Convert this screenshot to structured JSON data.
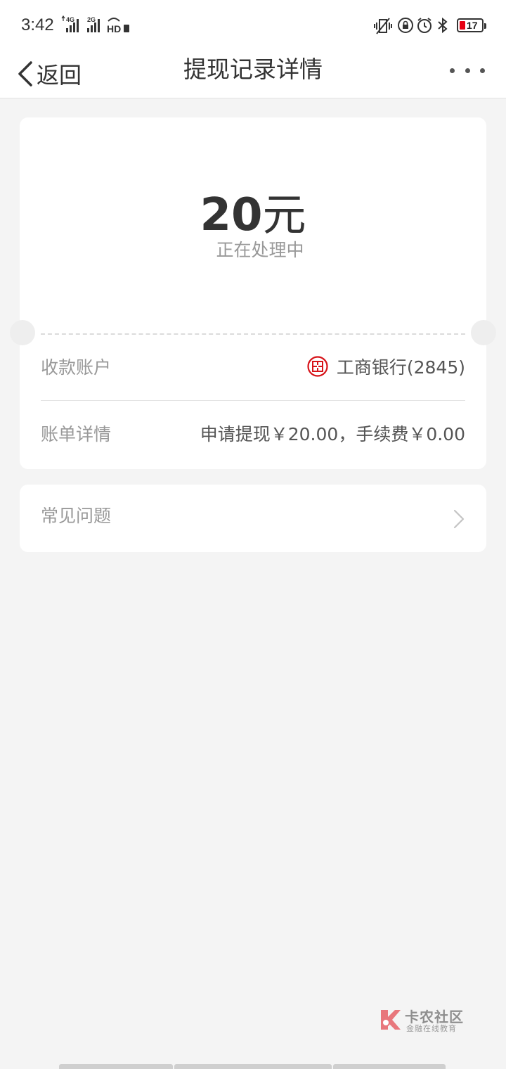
{
  "status_bar": {
    "time": "3:42",
    "network_1": "4G",
    "network_2": "2G",
    "hd_label": "HD",
    "battery_level": "17",
    "icons": [
      "vibrate-icon",
      "lock-rotation-icon",
      "alarm-icon",
      "bluetooth-icon",
      "battery-icon"
    ]
  },
  "nav": {
    "back_label": "返回",
    "title": "提现记录详情",
    "more_icon": "more-dots-icon"
  },
  "detail": {
    "amount": "20",
    "unit": "元",
    "status": "正在处理中",
    "rows": [
      {
        "label": "收款账户",
        "value": "工商银行(2845)",
        "icon": "icbc-logo"
      },
      {
        "label": "账单详情",
        "value": "申请提现￥20.00，手续费￥0.00"
      }
    ]
  },
  "faq": {
    "label": "常见问题",
    "icon": "chevron-right-icon"
  },
  "watermark": {
    "title": "卡农社区",
    "subtitle": "金融在线教育"
  },
  "colors": {
    "accent_red": "#e60012",
    "background": "#f4f4f4",
    "card": "#ffffff"
  }
}
